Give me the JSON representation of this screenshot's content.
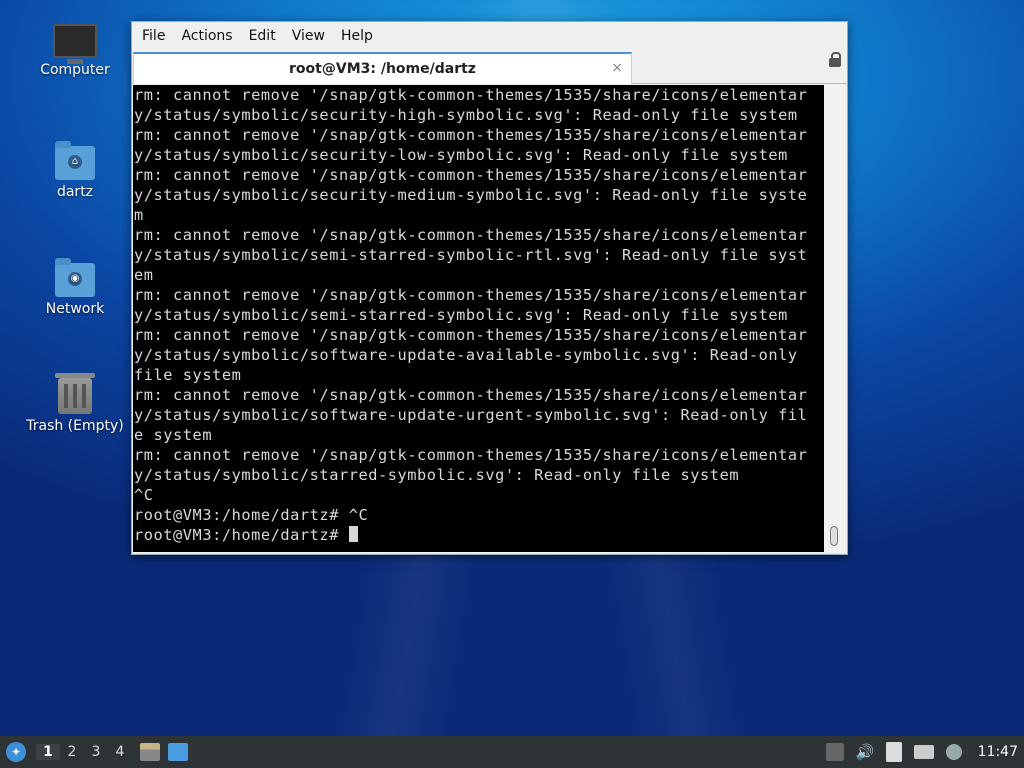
{
  "desktop": {
    "icons": [
      {
        "label": "Computer",
        "icon": "computer-icon"
      },
      {
        "label": "dartz",
        "icon": "home-folder-icon"
      },
      {
        "label": "Network",
        "icon": "network-folder-icon"
      },
      {
        "label": "Trash (Empty)",
        "icon": "trash-icon"
      }
    ]
  },
  "window": {
    "menu": [
      "File",
      "Actions",
      "Edit",
      "View",
      "Help"
    ],
    "tab_title": "root@VM3: /home/dartz",
    "tab_close": "×",
    "terminal_lines": [
      "rm: cannot remove '/snap/gtk-common-themes/1535/share/icons/elementar",
      "y/status/symbolic/security-high-symbolic.svg': Read-only file system",
      "rm: cannot remove '/snap/gtk-common-themes/1535/share/icons/elementar",
      "y/status/symbolic/security-low-symbolic.svg': Read-only file system",
      "rm: cannot remove '/snap/gtk-common-themes/1535/share/icons/elementar",
      "y/status/symbolic/security-medium-symbolic.svg': Read-only file syste",
      "m",
      "rm: cannot remove '/snap/gtk-common-themes/1535/share/icons/elementar",
      "y/status/symbolic/semi-starred-symbolic-rtl.svg': Read-only file syst",
      "em",
      "rm: cannot remove '/snap/gtk-common-themes/1535/share/icons/elementar",
      "y/status/symbolic/semi-starred-symbolic.svg': Read-only file system",
      "rm: cannot remove '/snap/gtk-common-themes/1535/share/icons/elementar",
      "y/status/symbolic/software-update-available-symbolic.svg': Read-only",
      "file system",
      "rm: cannot remove '/snap/gtk-common-themes/1535/share/icons/elementar",
      "y/status/symbolic/software-update-urgent-symbolic.svg': Read-only fil",
      "e system",
      "rm: cannot remove '/snap/gtk-common-themes/1535/share/icons/elementar",
      "y/status/symbolic/starred-symbolic.svg': Read-only file system",
      "^C",
      "root@VM3:/home/dartz# ^C"
    ],
    "prompt": "root@VM3:/home/dartz# "
  },
  "taskbar": {
    "workspaces": [
      "1",
      "2",
      "3",
      "4"
    ],
    "active_workspace": "1",
    "clock": "11:47"
  }
}
